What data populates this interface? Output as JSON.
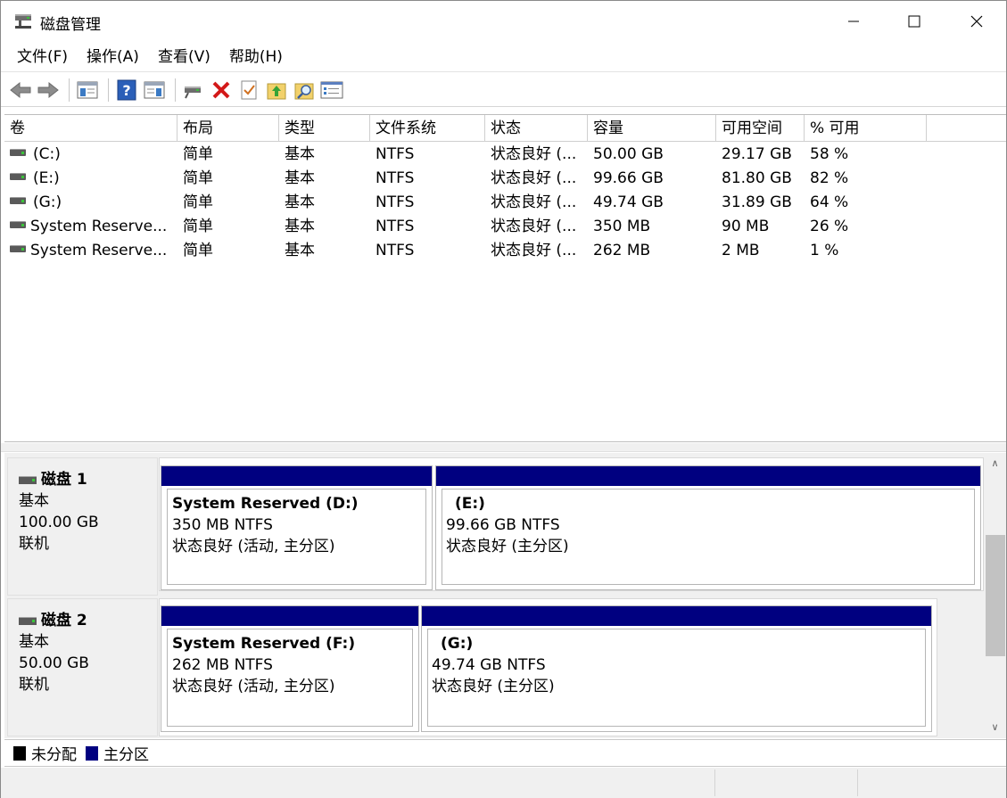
{
  "window": {
    "title": "磁盘管理",
    "icon": "disk-management-icon",
    "controls": [
      "minimize-icon",
      "maximize-icon",
      "close-icon"
    ]
  },
  "menu": [
    "文件(F)",
    "操作(A)",
    "查看(V)",
    "帮助(H)"
  ],
  "toolbar": {
    "buttons": [
      "back-arrow-icon",
      "forward-arrow-icon",
      "show-hide-console-tree-icon",
      "help-icon",
      "show-hide-action-pane-icon",
      "connect-virtual-disk-icon",
      "delete-icon",
      "check-icon",
      "up-folder-icon",
      "search-folder-icon",
      "properties-list-icon"
    ]
  },
  "volume_list": {
    "columns": [
      "卷",
      "布局",
      "类型",
      "文件系统",
      "状态",
      "容量",
      "可用空间",
      "% 可用"
    ],
    "rows": [
      [
        "(C:)",
        "简单",
        "基本",
        "NTFS",
        "状态良好 (...",
        "50.00 GB",
        "29.17 GB",
        "58 %"
      ],
      [
        "(E:)",
        "简单",
        "基本",
        "NTFS",
        "状态良好 (...",
        "99.66 GB",
        "81.80 GB",
        "82 %"
      ],
      [
        "(G:)",
        "简单",
        "基本",
        "NTFS",
        "状态良好 (...",
        "49.74 GB",
        "31.89 GB",
        "64 %"
      ],
      [
        "System Reserve...",
        "简单",
        "基本",
        "NTFS",
        "状态良好 (...",
        "350 MB",
        "90 MB",
        "26 %"
      ],
      [
        "System Reserve...",
        "简单",
        "基本",
        "NTFS",
        "状态良好 (...",
        "262 MB",
        "2 MB",
        "1 %"
      ]
    ]
  },
  "disks": [
    {
      "name": "磁盘 1",
      "type": "基本",
      "size": "100.00 GB",
      "status": "联机",
      "partitions": [
        {
          "name": "System Reserved  (D:)",
          "size_fs": "350 MB NTFS",
          "status": "状态良好 (活动, 主分区)"
        },
        {
          "name": "(E:)",
          "size_fs": "99.66 GB NTFS",
          "status": "状态良好 (主分区)"
        }
      ]
    },
    {
      "name": "磁盘 2",
      "type": "基本",
      "size": "50.00 GB",
      "status": "联机",
      "partitions": [
        {
          "name": "System Reserved  (F:)",
          "size_fs": "262 MB NTFS",
          "status": "状态良好 (活动, 主分区)"
        },
        {
          "name": "(G:)",
          "size_fs": "49.74 GB NTFS",
          "status": "状态良好 (主分区)"
        }
      ]
    }
  ],
  "legend": [
    {
      "label": "未分配",
      "color": "#000000"
    },
    {
      "label": "主分区",
      "color": "#000080"
    }
  ],
  "colors": {
    "primary_partition_bar": "#000080",
    "unallocated": "#000000"
  }
}
